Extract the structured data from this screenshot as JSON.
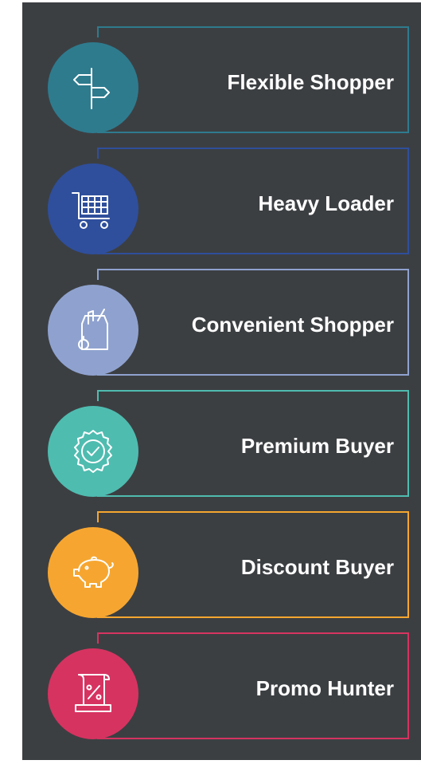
{
  "items": [
    {
      "label": "Flexible Shopper",
      "color": "#2e7b8e",
      "icon": "signpost-icon"
    },
    {
      "label": "Heavy Loader",
      "color": "#2f4f9c",
      "icon": "shopping-cart-icon"
    },
    {
      "label": "Convenient Shopper",
      "color": "#8fa2cf",
      "icon": "grocery-bag-icon"
    },
    {
      "label": "Premium Buyer",
      "color": "#4fbcb0",
      "icon": "quality-badge-icon"
    },
    {
      "label": "Discount Buyer",
      "color": "#f6a630",
      "icon": "piggy-bank-icon"
    },
    {
      "label": "Promo Hunter",
      "color": "#d63361",
      "icon": "discount-receipt-icon"
    }
  ]
}
